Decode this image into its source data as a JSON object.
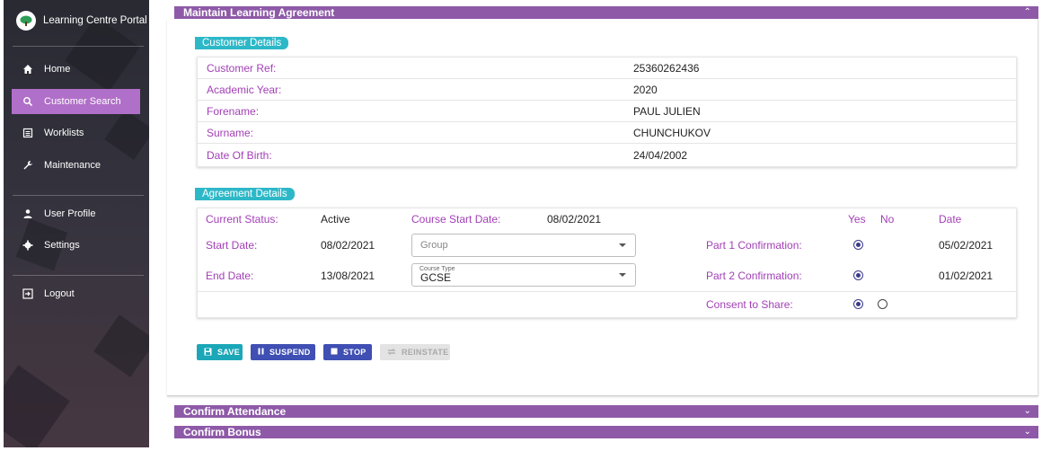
{
  "app": {
    "title": "Learning Centre Portal"
  },
  "sidebar": {
    "items": [
      {
        "label": "Home",
        "icon": "home-icon"
      },
      {
        "label": "Customer Search",
        "icon": "search-icon"
      },
      {
        "label": "Worklists",
        "icon": "list-icon"
      },
      {
        "label": "Maintenance",
        "icon": "wrench-icon"
      },
      {
        "label": "User Profile",
        "icon": "person-icon"
      },
      {
        "label": "Settings",
        "icon": "gear-icon"
      },
      {
        "label": "Logout",
        "icon": "logout-icon"
      }
    ],
    "active": "Customer Search"
  },
  "panels": {
    "maintain": "Maintain Learning Agreement",
    "attendance": "Confirm Attendance",
    "bonus": "Confirm Bonus"
  },
  "customer": {
    "heading": "Customer Details",
    "rows": [
      {
        "label": "Customer Ref:",
        "value": "25360262436"
      },
      {
        "label": "Academic Year:",
        "value": "2020"
      },
      {
        "label": "Forename:",
        "value": "PAUL JULIEN"
      },
      {
        "label": "Surname:",
        "value": "CHUNCHUKOV"
      },
      {
        "label": "Date Of Birth:",
        "value": "24/04/2002"
      }
    ]
  },
  "agreement": {
    "heading": "Agreement Details",
    "current_status_label": "Current Status:",
    "current_status": "Active",
    "course_start_label": "Course Start Date:",
    "course_start": "08/02/2021",
    "start_date_label": "Start Date:",
    "start_date": "08/02/2021",
    "end_date_label": "End Date:",
    "end_date": "13/08/2021",
    "group_placeholder": "Group",
    "course_type_label": "Course Type",
    "course_type": "GCSE",
    "yes_label": "Yes",
    "no_label": "No",
    "date_label": "Date",
    "part1_label": "Part 1 Confirmation:",
    "part1_date": "05/02/2021",
    "part2_label": "Part 2 Confirmation:",
    "part2_date": "01/02/2021",
    "consent_label": "Consent to Share:"
  },
  "buttons": {
    "save": "SAVE",
    "suspend": "SUSPEND",
    "stop": "STOP",
    "reinstate": "REINSTATE"
  },
  "colors": {
    "accent_purple": "#8e5aa8",
    "label_purple": "#a23fb6",
    "teal": "#2db8c8",
    "indigo": "#3f4fb3"
  }
}
